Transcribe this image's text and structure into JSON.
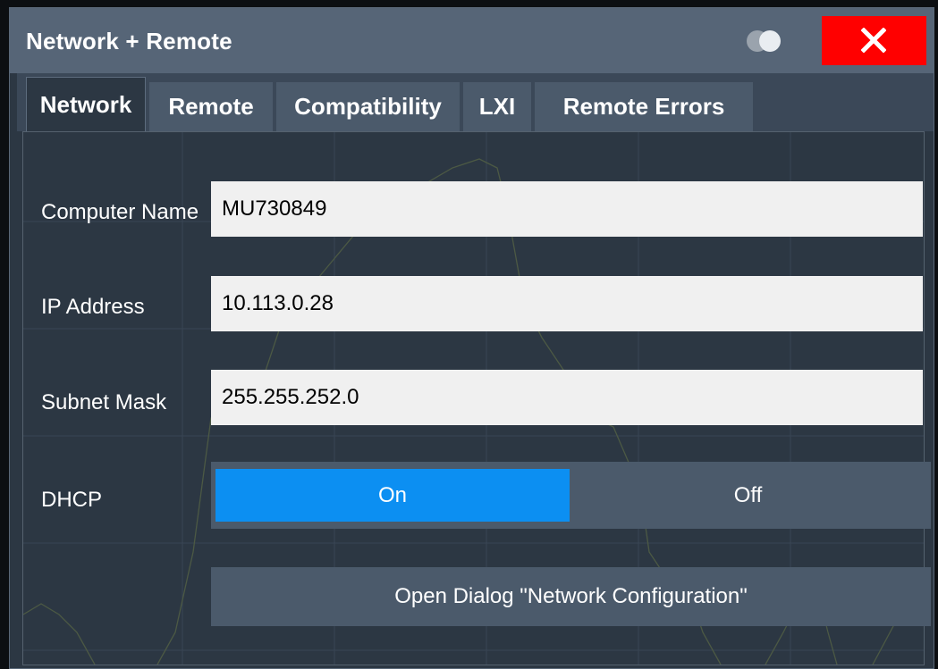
{
  "dialog": {
    "title": "Network + Remote",
    "icons": {
      "toggle": "toggle-icon",
      "close": "close-icon"
    }
  },
  "tabs": [
    {
      "label": "Network",
      "active": true
    },
    {
      "label": "Remote",
      "active": false
    },
    {
      "label": "Compatibility",
      "active": false
    },
    {
      "label": "LXI",
      "active": false
    },
    {
      "label": "Remote Errors",
      "active": false
    }
  ],
  "network": {
    "computer_name": {
      "label": "Computer Name",
      "value": "MU730849"
    },
    "ip_address": {
      "label": "IP Address",
      "value": "10.113.0.28"
    },
    "subnet_mask": {
      "label": "Subnet Mask",
      "value": "255.255.252.0"
    },
    "dhcp": {
      "label": "DHCP",
      "on_label": "On",
      "off_label": "Off",
      "selected": "On"
    },
    "open_dialog_label": "Open Dialog \"Network Configuration\""
  },
  "colors": {
    "titlebar": "#566577",
    "close": "#ff0000",
    "selected": "#0c8ff2",
    "panel": "#2c3743",
    "control": "#4b5a6b"
  }
}
